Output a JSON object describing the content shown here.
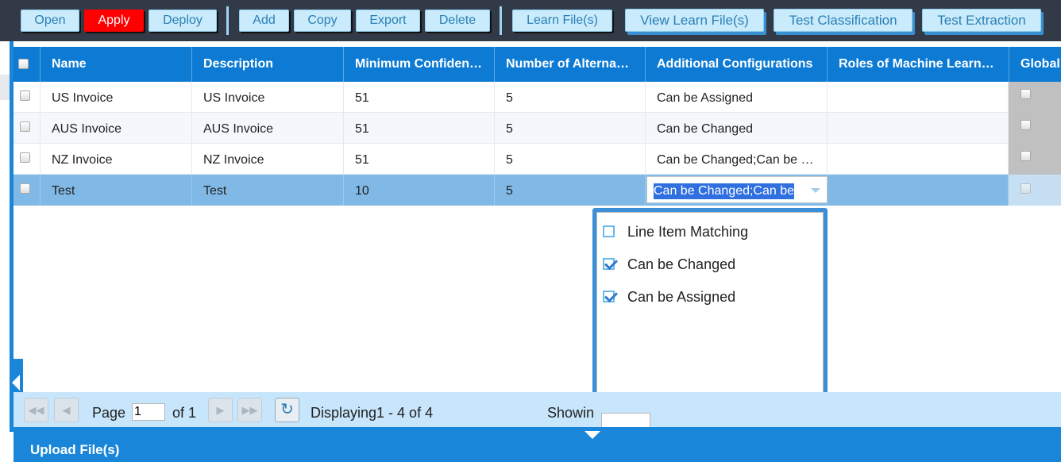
{
  "toolbar": {
    "group1": [
      {
        "id": "open",
        "label": "Open"
      },
      {
        "id": "apply",
        "label": "Apply"
      },
      {
        "id": "deploy",
        "label": "Deploy"
      }
    ],
    "group2": [
      {
        "id": "add",
        "label": "Add"
      },
      {
        "id": "copy",
        "label": "Copy"
      },
      {
        "id": "export",
        "label": "Export"
      },
      {
        "id": "delete",
        "label": "Delete"
      }
    ],
    "group3": [
      {
        "id": "learn-files",
        "label": "Learn File(s)"
      },
      {
        "id": "view-learn-files",
        "label": "View Learn File(s)"
      },
      {
        "id": "test-classification",
        "label": "Test Classification"
      },
      {
        "id": "test-extraction",
        "label": "Test Extraction"
      }
    ]
  },
  "colors": {
    "apply": "#ff0000",
    "header": "#0d7bd4",
    "selected_row": "#80b9e6",
    "accent": "#1a86d9"
  },
  "grid": {
    "columns": [
      "Name",
      "Description",
      "Minimum Confiden…",
      "Number of Alterna…",
      "Additional Configurations",
      "Roles of Machine Learn…",
      "Global"
    ],
    "rows": [
      {
        "name": "US Invoice",
        "description": "US Invoice",
        "min_confidence": "51",
        "alternatives": "5",
        "additional": "Can be Assigned",
        "roles": ""
      },
      {
        "name": "AUS Invoice",
        "description": "AUS Invoice",
        "min_confidence": "51",
        "alternatives": "5",
        "additional": "Can be Changed",
        "roles": ""
      },
      {
        "name": "NZ Invoice",
        "description": "NZ Invoice",
        "min_confidence": "51",
        "alternatives": "5",
        "additional": "Can be Changed;Can be …",
        "roles": ""
      },
      {
        "name": "Test",
        "description": "Test",
        "min_confidence": "10",
        "alternatives": "5",
        "additional": "",
        "roles": ""
      }
    ],
    "editor_value": "Can be Changed;Can be"
  },
  "dropdown": {
    "options": [
      {
        "label": "Line Item Matching",
        "checked": false
      },
      {
        "label": "Can be Changed",
        "checked": true
      },
      {
        "label": "Can be Assigned",
        "checked": true
      }
    ]
  },
  "paging": {
    "page_label": "Page",
    "page_value": "1",
    "of_label": "of 1",
    "displaying": "Displaying1 - 4 of 4",
    "showing_label": "Showin",
    "icons": [
      "first-page-icon",
      "previous-page-icon",
      "next-page-icon",
      "last-page-icon",
      "refresh-icon"
    ]
  },
  "bottom": {
    "title": "Upload File(s)"
  }
}
